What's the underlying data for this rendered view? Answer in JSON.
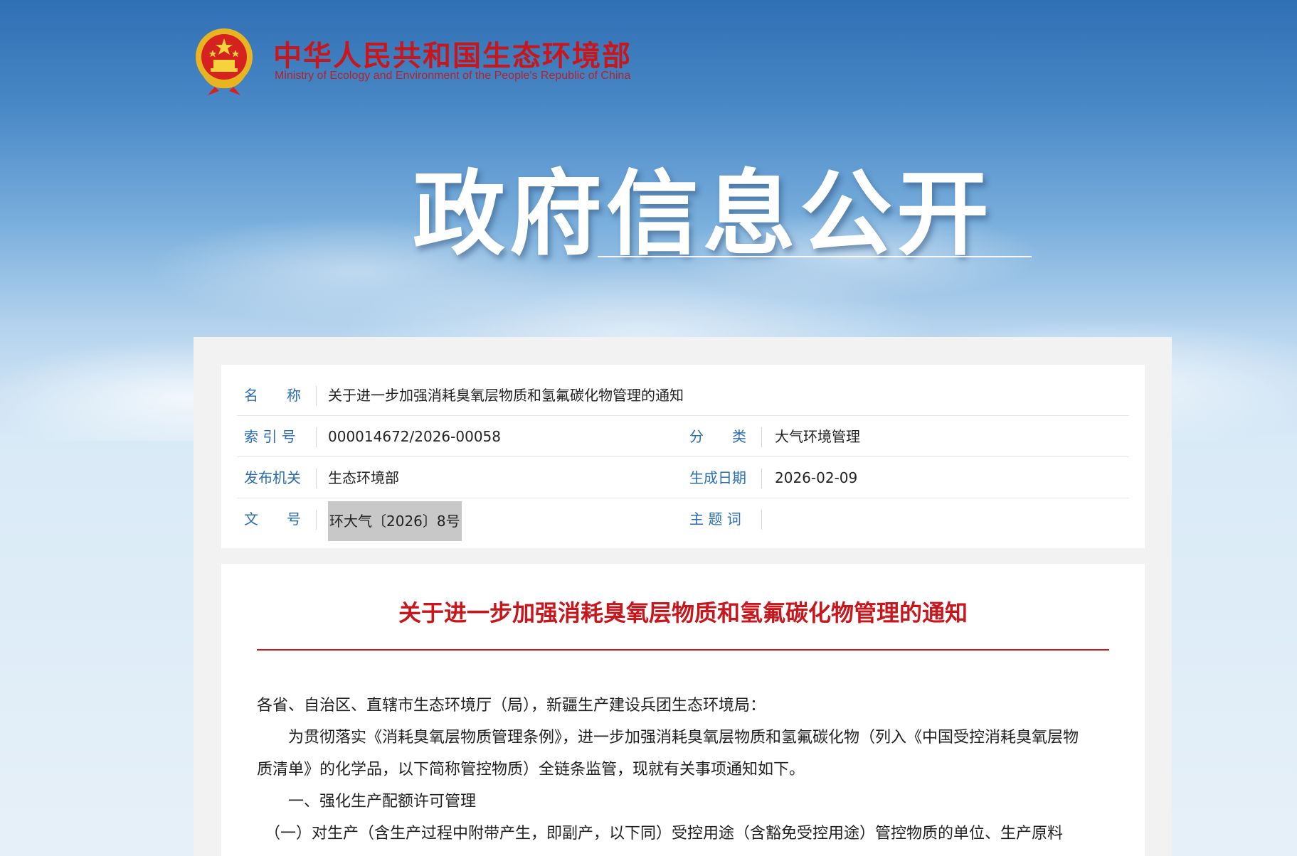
{
  "header": {
    "site_name_cn": "中华人民共和国生态环境部",
    "site_name_en": "Ministry of Ecology and Environment of the People's Republic of China",
    "hero_title": "政府信息公开"
  },
  "meta": {
    "name_label": "名　　称",
    "name_value": "关于进一步加强消耗臭氧层物质和氢氟碳化物管理的通知",
    "index_label": "索 引 号",
    "index_value": "000014672/2026-00058",
    "category_label": "分　　类",
    "category_value": "大气环境管理",
    "issuer_label": "发布机关",
    "issuer_value": "生态环境部",
    "date_label": "生成日期",
    "date_value": "2026-02-09",
    "docno_label": "文　　号",
    "docno_value": "环大气〔2026〕8号",
    "subject_label": "主 题 词",
    "subject_value": ""
  },
  "document": {
    "title": "关于进一步加强消耗臭氧层物质和氢氟碳化物管理的通知",
    "paragraphs": [
      "各省、自治区、直辖市生态环境厅（局），新疆生产建设兵团生态环境局：",
      "　　为贯彻落实《消耗臭氧层物质管理条例》，进一步加强消耗臭氧层物质和氢氟碳化物（列入《中国受控消耗臭氧层物",
      "质清单》的化学品，以下简称管控物质）全链条监管，现就有关事项通知如下。",
      "　　一、强化生产配额许可管理",
      "　（一）对生产（含生产过程中附带产生，即副产，以下同）受控用途（含豁免受控用途）管控物质的单位、生产原料"
    ]
  },
  "colors": {
    "brand_red": "#c8161d",
    "label_blue": "#2a6db3"
  }
}
